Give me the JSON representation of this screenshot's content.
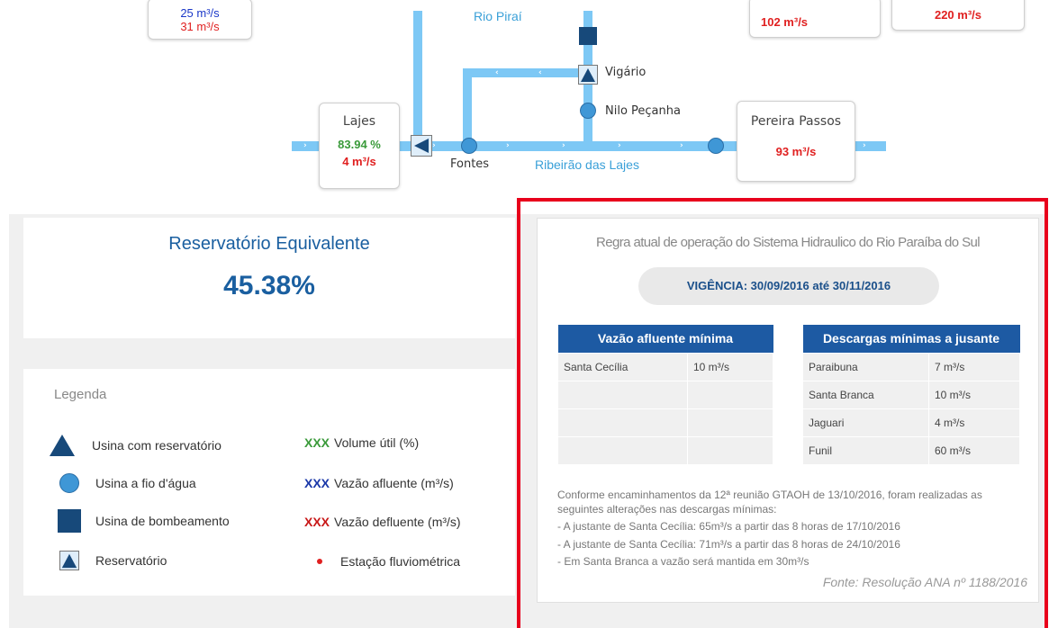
{
  "diagram": {
    "top_left_box": {
      "line1": "25 m³/s",
      "line2": "31 m³/s"
    },
    "top_mid_value": "102 m³/s",
    "top_right_value": "220 m³/s",
    "rio_pirai": "Rio Piraí",
    "vigario": "Vigário",
    "nilo_pecanha": "Nilo Peçanha",
    "fontes": "Fontes",
    "ribeirao": "Ribeirão das Lajes",
    "lajes": {
      "title": "Lajes",
      "pct": "83.94 %",
      "flow": "4 m³/s"
    },
    "pereira_passos": {
      "title": "Pereira Passos",
      "flow": "93 m³/s"
    }
  },
  "reservatorio": {
    "title": "Reservatório Equivalente",
    "value": "45.38%"
  },
  "legenda": {
    "title": "Legenda",
    "items": [
      "Usina com reservatório",
      "Usina a fio d'água",
      "Usina de bombeamento",
      "Reservatório"
    ],
    "xxx": "XXX",
    "vol": "Volume útil (%)",
    "afl": "Vazão afluente (m³/s)",
    "defl": "Vazão defluente (m³/s)",
    "estacao": "Estação fluviométrica"
  },
  "regra": {
    "title": "Regra atual de operação do Sistema Hidraulico do Rio Paraíba do Sul",
    "vigencia": "VIGÊNCIA: 30/09/2016 até 30/11/2016",
    "afluente": {
      "header": "Vazão afluente mínima",
      "rows": [
        [
          "Santa Cecília",
          "10 m³/s"
        ],
        [
          "",
          ""
        ],
        [
          "",
          ""
        ],
        [
          "",
          ""
        ]
      ]
    },
    "jusante": {
      "header": "Descargas mínimas a jusante",
      "rows": [
        [
          "Paraibuna",
          "7 m³/s"
        ],
        [
          "Santa Branca",
          "10 m³/s"
        ],
        [
          "Jaguari",
          "4 m³/s"
        ],
        [
          "Funil",
          "60 m³/s"
        ]
      ]
    },
    "notes": [
      "Conforme encaminhamentos da 12ª reunião GTAOH de 13/10/2016, foram realizadas as seguintes alterações nas descargas mínimas:",
      "- A justante de Santa Cecília: 65m³/s a partir das 8 horas de 17/10/2016",
      "- A justante de Santa Cecília: 71m³/s a partir das 8 horas de 24/10/2016",
      "- Em Santa Branca a vazão será mantida em 30m³/s"
    ],
    "fonte": "Fonte: Resolução ANA nº 1188/2016"
  },
  "colors": {
    "highlight": "#e8001c",
    "table_header": "#1d5aa3",
    "river": "#7dc8f5"
  }
}
